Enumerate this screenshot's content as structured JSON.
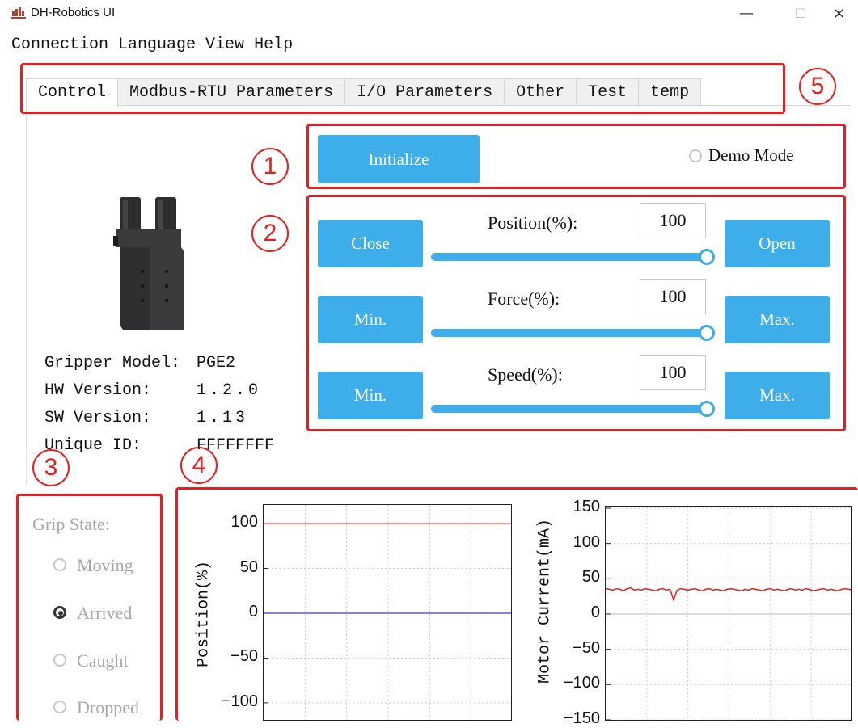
{
  "window": {
    "title": "DH-Robotics UI",
    "minimize_glyph": "—",
    "maximize_glyph": "☐",
    "close_glyph": "×"
  },
  "menu": [
    "Connection",
    "Language",
    "View",
    "Help"
  ],
  "tabs": [
    "Control",
    "Modbus-RTU Parameters",
    "I/O Parameters",
    "Other",
    "Test",
    "temp"
  ],
  "active_tab": "Control",
  "annotations": [
    "1",
    "2",
    "3",
    "4",
    "5"
  ],
  "initialize": {
    "button_label": "Initialize",
    "demo_mode_label": "Demo Mode",
    "demo_mode_checked": false
  },
  "controls": {
    "position": {
      "label": "Position(%):",
      "value": "100",
      "left_button": "Close",
      "right_button": "Open",
      "slider_fraction": 1.0
    },
    "force": {
      "label": "Force(%):",
      "value": "100",
      "left_button": "Min.",
      "right_button": "Max.",
      "slider_fraction": 1.0
    },
    "speed": {
      "label": "Speed(%):",
      "value": "100",
      "left_button": "Min.",
      "right_button": "Max.",
      "slider_fraction": 1.0
    }
  },
  "gripper_info": {
    "model_label": "Gripper Model:",
    "model_value": "PGE2",
    "hw_label": "HW Version:",
    "hw_value": "1.2.0",
    "sw_label": "SW Version:",
    "sw_value": "1.13",
    "id_label": "Unique ID:",
    "id_value": "FFFFFFFF"
  },
  "grip_state": {
    "title": "Grip State:",
    "options": [
      {
        "label": "Moving",
        "checked": false
      },
      {
        "label": "Arrived",
        "checked": true
      },
      {
        "label": "Caught",
        "checked": false
      },
      {
        "label": "Dropped",
        "checked": false
      }
    ]
  },
  "colors": {
    "accent": "#3daee9",
    "annotation": "#e51f1f",
    "target_line": "#e05050",
    "actual_line": "#5a5adc",
    "current_line": "#e02020"
  },
  "chart_data": [
    {
      "type": "line",
      "title": "",
      "xlabel": "",
      "ylabel": "Position(%)",
      "ylim": [
        -110,
        110
      ],
      "yticks": [
        100,
        50,
        0,
        -50,
        -100
      ],
      "grid": true,
      "series": [
        {
          "values": [
            100,
            100,
            100,
            100,
            100,
            100,
            100,
            100,
            100,
            100
          ]
        },
        {
          "values": [
            0,
            0,
            0,
            0,
            0,
            0,
            0,
            0,
            0,
            0
          ]
        }
      ]
    },
    {
      "type": "line",
      "title": "",
      "xlabel": "",
      "ylabel": "Motor Current(mA)",
      "ylim": [
        -150,
        150
      ],
      "yticks": [
        150,
        100,
        50,
        0,
        -50,
        -100,
        -150
      ],
      "grid": true,
      "series": [
        {
          "values": [
            36,
            35,
            34,
            36,
            35,
            33,
            36,
            37,
            34,
            35,
            34,
            36,
            35,
            34,
            33,
            35,
            36,
            34,
            35,
            20,
            34,
            36,
            35,
            34,
            35,
            36,
            34,
            33,
            35,
            36,
            34,
            35,
            34,
            33,
            35,
            36,
            35,
            34,
            33,
            35,
            34,
            36,
            35,
            34,
            33,
            35,
            36,
            34,
            35,
            34,
            33,
            35,
            36,
            34,
            35,
            34,
            36,
            35,
            33,
            34,
            35,
            36,
            34,
            35,
            34,
            33,
            35,
            36,
            35,
            34
          ]
        }
      ]
    }
  ]
}
